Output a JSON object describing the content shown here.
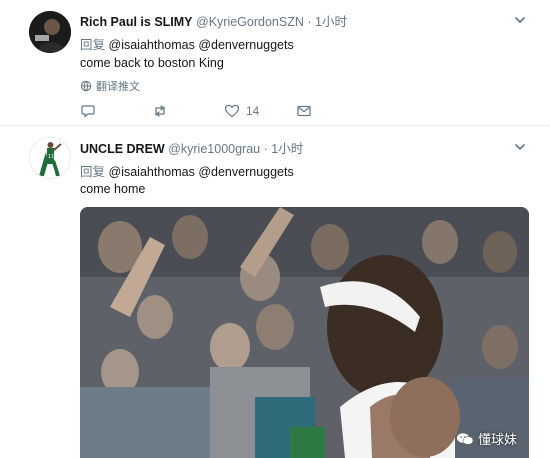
{
  "colors": {
    "text_primary": "#14171a",
    "text_secondary": "#657786",
    "divider": "#e6ecf0"
  },
  "tweets": [
    {
      "display_name": "Rich Paul is SLIMY",
      "handle": "@KyrieGordonSZN",
      "separator": "·",
      "time": "1小时",
      "reply_label": "回复",
      "mentions": [
        "@isaiahthomas",
        "@denvernuggets"
      ],
      "text": "come back to boston King",
      "translate_label": "翻译推文",
      "likes": "14",
      "icons": [
        "caret-down-icon",
        "reply-icon",
        "retweet-icon",
        "heart-icon",
        "message-icon",
        "translate-globe-icon"
      ]
    },
    {
      "display_name": "UNCLE DREW",
      "handle": "@kyrie1000grau",
      "separator": "·",
      "time": "1小时",
      "reply_label": "回复",
      "mentions": [
        "@isaiahthomas",
        "@denvernuggets"
      ],
      "text": "come home",
      "media_watermark": "懂球妹",
      "icons": [
        "caret-down-icon",
        "wechat-icon"
      ]
    }
  ]
}
